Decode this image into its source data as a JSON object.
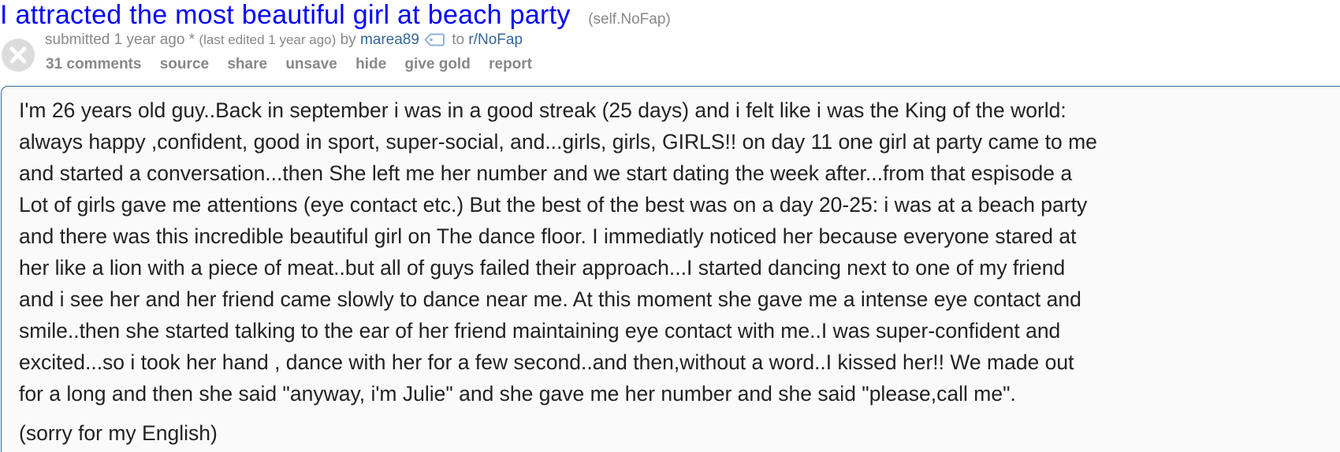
{
  "post": {
    "title": "I attracted the most beautiful girl at beach party",
    "domain": "(self.NoFap)",
    "tagline": {
      "submitted": "submitted",
      "time": "1 year ago",
      "edited_marker": "*",
      "edited": "(last edited 1 year ago)",
      "by": "by",
      "author": "marea89",
      "to": "to",
      "subreddit": "r/NoFap"
    },
    "buttons": [
      "31 comments",
      "source",
      "share",
      "unsave",
      "hide",
      "give gold",
      "report"
    ],
    "body": {
      "paragraph_1": "I'm 26 years old guy..Back in september i was in a good streak (25 days) and i felt like i was the King of the world:\nalways happy ,confident, good in sport, super-social, and...girls, girls, GIRLS!! on day 11 one girl at party came to me\nand started a conversation...then She left me her number and we start dating the week after...from that espisode a\nLot of girls gave me attentions (eye contact etc.) But the best of the best was on a day 20-25: i was at a beach party\nand there was this incredible beautiful girl on The dance floor. I immediatly noticed her because everyone stared at\nher like a lion with a piece of meat..but all of guys failed their approach...I started dancing next to one of my friend\nand i see her and her friend came slowly to dance near me. At this moment she gave me a intense eye contact and\nsmile..then she started talking to the ear of her friend maintaining eye contact with me..I was super-confident and\nexcited...so i took her hand , dance with her for a few second..and then,without a word..I kissed her!! We made out\nfor a long and then she said \"anyway, i'm Julie\" and she gave me her number and she said \"please,call me\".",
      "paragraph_2": "(sorry for my English)"
    }
  },
  "icons": {
    "close": "close-icon",
    "tag": "tag-icon"
  },
  "colors": {
    "title_link": "#0000ff",
    "meta_link": "#336699",
    "muted": "#888888",
    "expando_border": "#336699",
    "expando_bg": "#fafafa"
  }
}
